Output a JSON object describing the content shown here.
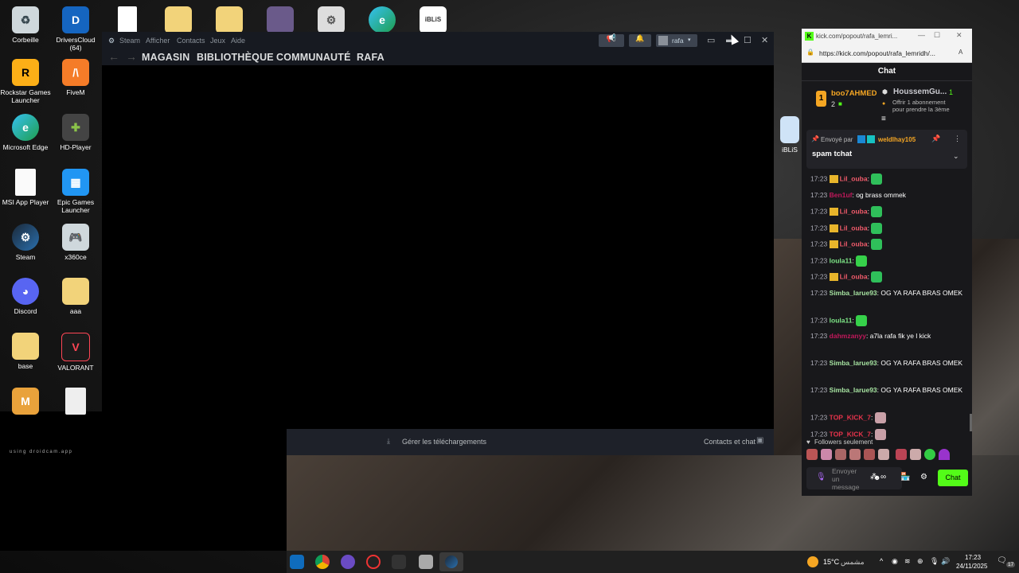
{
  "desktop": {
    "icons": [
      {
        "label": "Corbeille"
      },
      {
        "label": "DriversCloud (64)"
      },
      {
        "label": "Rockstar Games Launcher"
      },
      {
        "label": "FiveM"
      },
      {
        "label": "Microsoft Edge"
      },
      {
        "label": "HD-Player"
      },
      {
        "label": "MSI App Player"
      },
      {
        "label": "Epic Games Launcher"
      },
      {
        "label": "Steam"
      },
      {
        "label": "x360ce"
      },
      {
        "label": "Discord"
      },
      {
        "label": "aaa"
      },
      {
        "label": "base"
      },
      {
        "label": "VALORANT"
      },
      {
        "label": "iBLiS"
      }
    ],
    "watermark": "using droidcam.app"
  },
  "steam": {
    "menu": [
      "Steam",
      "Afficher",
      "Contacts",
      "Jeux",
      "Aide"
    ],
    "user": "rafa",
    "nav": [
      "MAGASIN",
      "BIBLIOTHÈQUE",
      "COMMUNAUTÉ",
      "RAFA"
    ],
    "downloads": "Gérer les téléchargements",
    "friends": "Contacts et chat"
  },
  "browser": {
    "tab_title": "kick.com/popout/rafa_lemri...",
    "url": "https://kick.com/popout/rafa_lemridh/...",
    "chat_header": "Chat",
    "top_gifter": {
      "name": "boo7AHMED",
      "count": "2",
      "rank": "1"
    },
    "goal": {
      "name": "HoussemGu...",
      "count": "1",
      "text1": "Offrir 1 abonnement",
      "text2": "pour prendre la 3ème"
    },
    "pinned": {
      "prefix": "Envoyé par",
      "user": "weldlhay105",
      "message": "spam tchat"
    },
    "messages": [
      {
        "time": "17:23",
        "user": "Lil_ouba",
        "text": "",
        "color": "#f25b6b",
        "crown": true,
        "emote": "#2fbf5a"
      },
      {
        "time": "17:23",
        "user": "Ben1uf",
        "text": "og brass ommek",
        "color": "#c2185b",
        "crown": false,
        "emote": ""
      },
      {
        "time": "17:23",
        "user": "Lil_ouba",
        "text": "",
        "color": "#f25b6b",
        "crown": true,
        "emote": "#2fbf5a"
      },
      {
        "time": "17:23",
        "user": "Lil_ouba",
        "text": "",
        "color": "#f25b6b",
        "crown": true,
        "emote": "#2fbf5a"
      },
      {
        "time": "17:23",
        "user": "Lil_ouba",
        "text": "",
        "color": "#f25b6b",
        "crown": true,
        "emote": "#2fbf5a"
      },
      {
        "time": "17:23",
        "user": "loula11",
        "text": "",
        "color": "#7ee787",
        "crown": false,
        "emote": "#36d14a"
      },
      {
        "time": "17:23",
        "user": "Lil_ouba",
        "text": "",
        "color": "#f25b6b",
        "crown": true,
        "emote": "#2fbf5a"
      },
      {
        "time": "17:23",
        "user": "Simba_larue93",
        "text": "OG YA RAFA BRAS OMEK",
        "color": "#a6e3a1",
        "crown": false,
        "emote": ""
      },
      {
        "time": "17:23",
        "user": "loula11",
        "text": "",
        "color": "#7ee787",
        "crown": false,
        "emote": "#36d14a"
      },
      {
        "time": "17:23",
        "user": "dahmzanyy",
        "text": "a7la rafa fik ye l kick",
        "color": "#c2185b",
        "crown": false,
        "emote": ""
      },
      {
        "time": "17:23",
        "user": "Simba_larue93",
        "text": "OG YA RAFA BRAS OMEK",
        "color": "#a6e3a1",
        "crown": false,
        "emote": ""
      },
      {
        "time": "17:23",
        "user": "Simba_larue93",
        "text": "OG YA RAFA BRAS OMEK",
        "color": "#a6e3a1",
        "crown": false,
        "emote": ""
      },
      {
        "time": "17:23",
        "user": "TOP_KICK_7",
        "text": "",
        "color": "#e5334b",
        "crown": false,
        "emote": "#c9a0a8"
      },
      {
        "time": "17:23",
        "user": "TOP_KICK_7",
        "text": "",
        "color": "#e5334b",
        "crown": false,
        "emote": "#c9a0a8"
      }
    ],
    "followers_only": "Followers seulement",
    "input_placeholder": "Envoyer un message",
    "send_label": "Chat"
  },
  "taskbar": {
    "weather_temp": "15°C",
    "weather_text": "مشمس",
    "time": "17:23",
    "date": "24/11/2025",
    "notif_count": "17"
  }
}
